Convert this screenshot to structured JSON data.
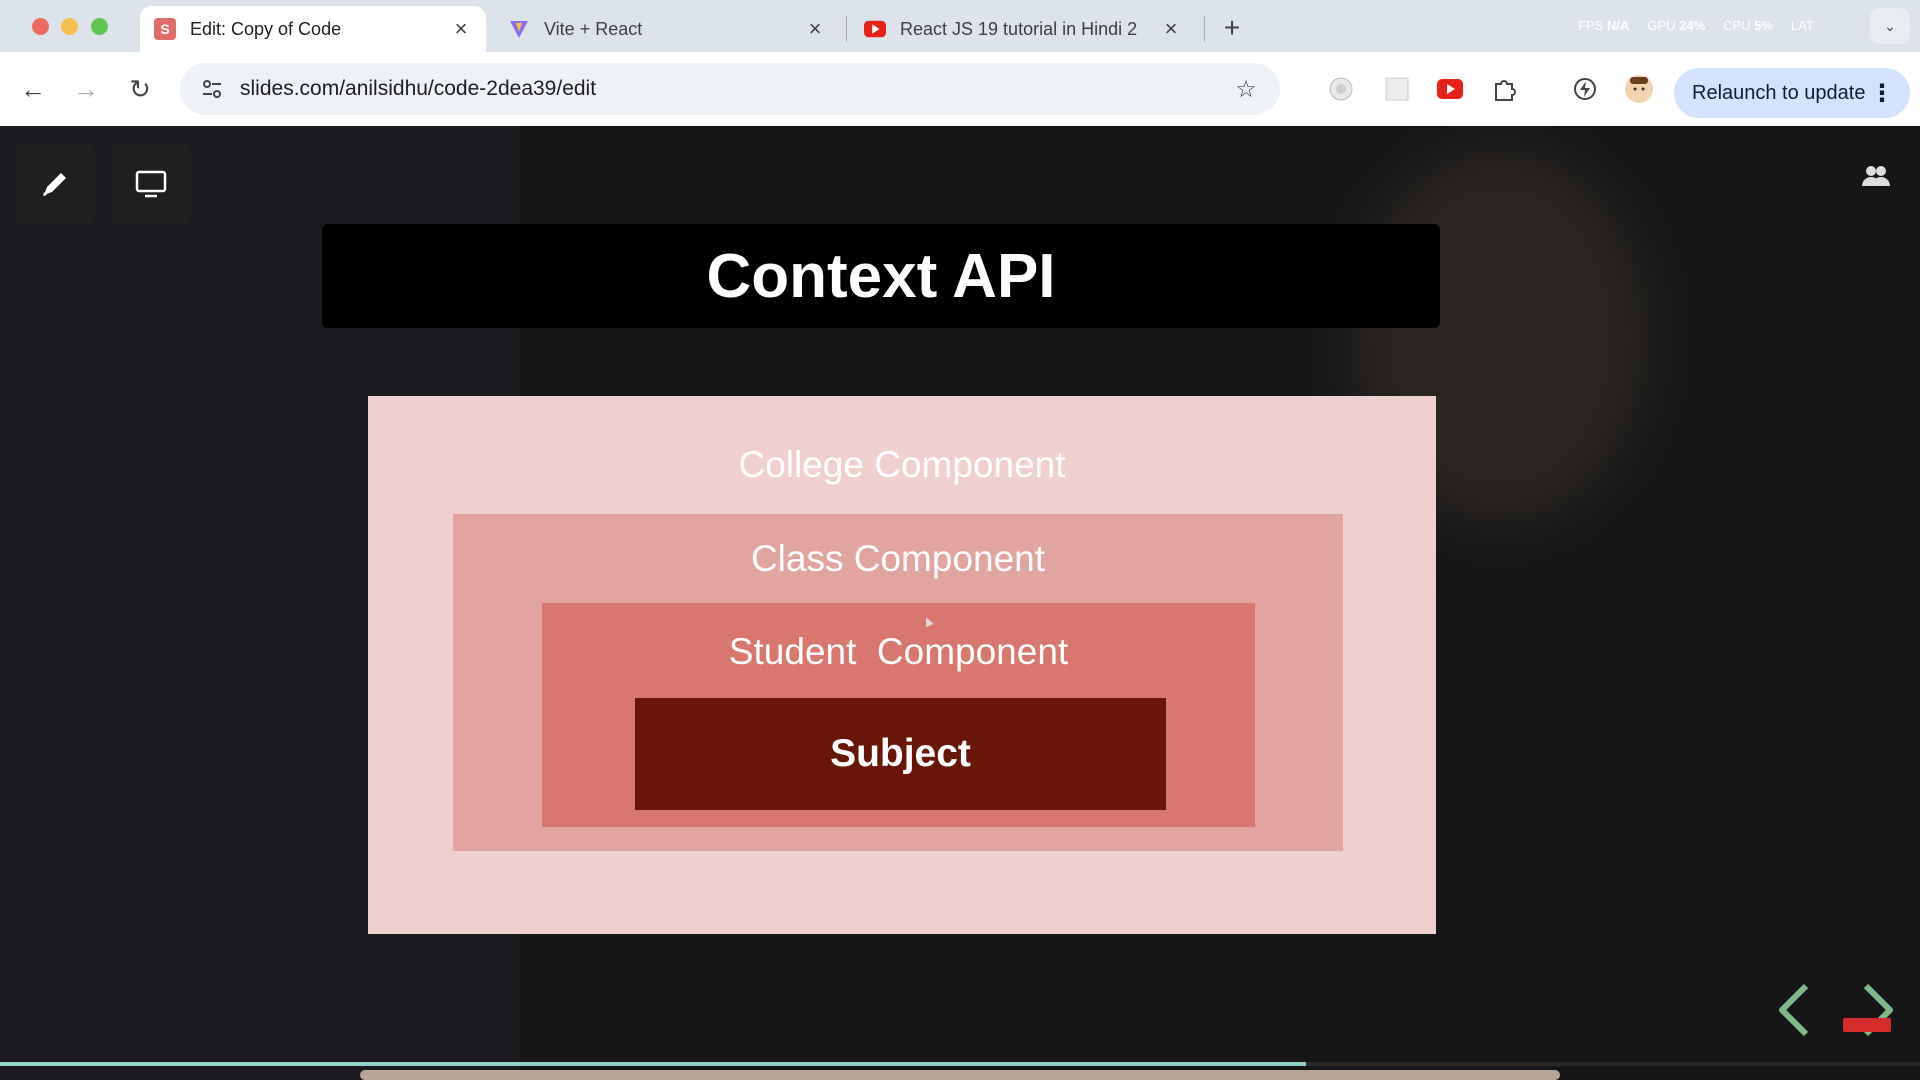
{
  "browser": {
    "tabs": [
      {
        "title": "Edit: Copy of Code",
        "favicon": "slides-favicon",
        "active": true
      },
      {
        "title": "Vite + React",
        "favicon": "vite-favicon",
        "active": false
      },
      {
        "title": "React JS 19 tutorial in Hindi 2",
        "favicon": "youtube-favicon",
        "active": false
      }
    ],
    "new_tab_label": "+",
    "close_glyph": "×",
    "stats": {
      "fps_label": "FPS",
      "fps_value": "N/A",
      "gpu_label": "GPU",
      "gpu_value": "24%",
      "cpu_label": "CPU",
      "cpu_value": "5%",
      "lat_label": "LAT"
    },
    "url": "slides.com/anilsidhu/code-2dea39/edit",
    "relaunch_label": "Relaunch to update"
  },
  "slide": {
    "title": "Context API",
    "college_label": "College Component",
    "class_label": "Class Component",
    "student_label": "Student  Component",
    "subject_label": "Subject"
  },
  "progress": {
    "fraction": 0.68
  },
  "colors": {
    "college": "#f0d0cf",
    "class": "#e2a49f",
    "student": "#d8776d",
    "subject": "#681608",
    "nav_arrow": "#7fb98a"
  }
}
